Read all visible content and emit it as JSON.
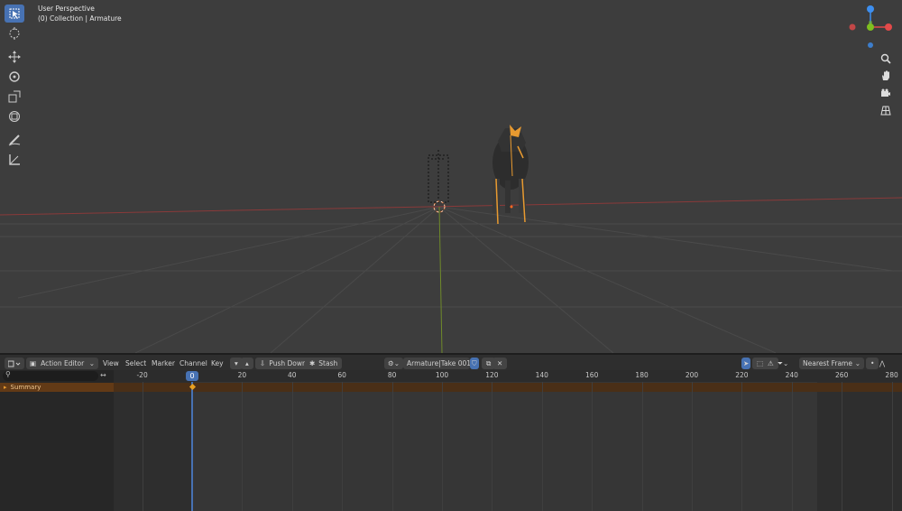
{
  "viewport": {
    "perspective_label": "User Perspective",
    "collection_label": "(0) Collection | Armature",
    "tools": [
      {
        "name": "select-box-icon"
      },
      {
        "name": "cursor-icon"
      },
      {
        "name": "move-icon"
      },
      {
        "name": "rotate-icon"
      },
      {
        "name": "scale-icon"
      },
      {
        "name": "transform-icon"
      },
      {
        "name": "annotate-icon"
      },
      {
        "name": "measure-icon"
      }
    ],
    "nav_buttons": [
      "zoom-icon",
      "hand-pan-icon",
      "camera-icon",
      "grid-icon"
    ],
    "gizmo_colors": {
      "x": "#e44a4a",
      "y": "#7fbf1f",
      "z": "#3d8ff0"
    }
  },
  "action_editor": {
    "editor_type": "Action Editor",
    "menus": [
      "View",
      "Select",
      "Marker",
      "Channel",
      "Key"
    ],
    "push_down": "Push Down",
    "stash": "Stash",
    "action_name": "Armature|Take 001|...",
    "snap_mode": "Nearest Frame",
    "current_frame": "0",
    "ruler_ticks": [
      "-20",
      "20",
      "40",
      "60",
      "80",
      "100",
      "120",
      "140",
      "160",
      "180",
      "200",
      "220",
      "240",
      "260",
      "280"
    ],
    "summary_label": "Summary",
    "accent_color": "#4772b3"
  }
}
